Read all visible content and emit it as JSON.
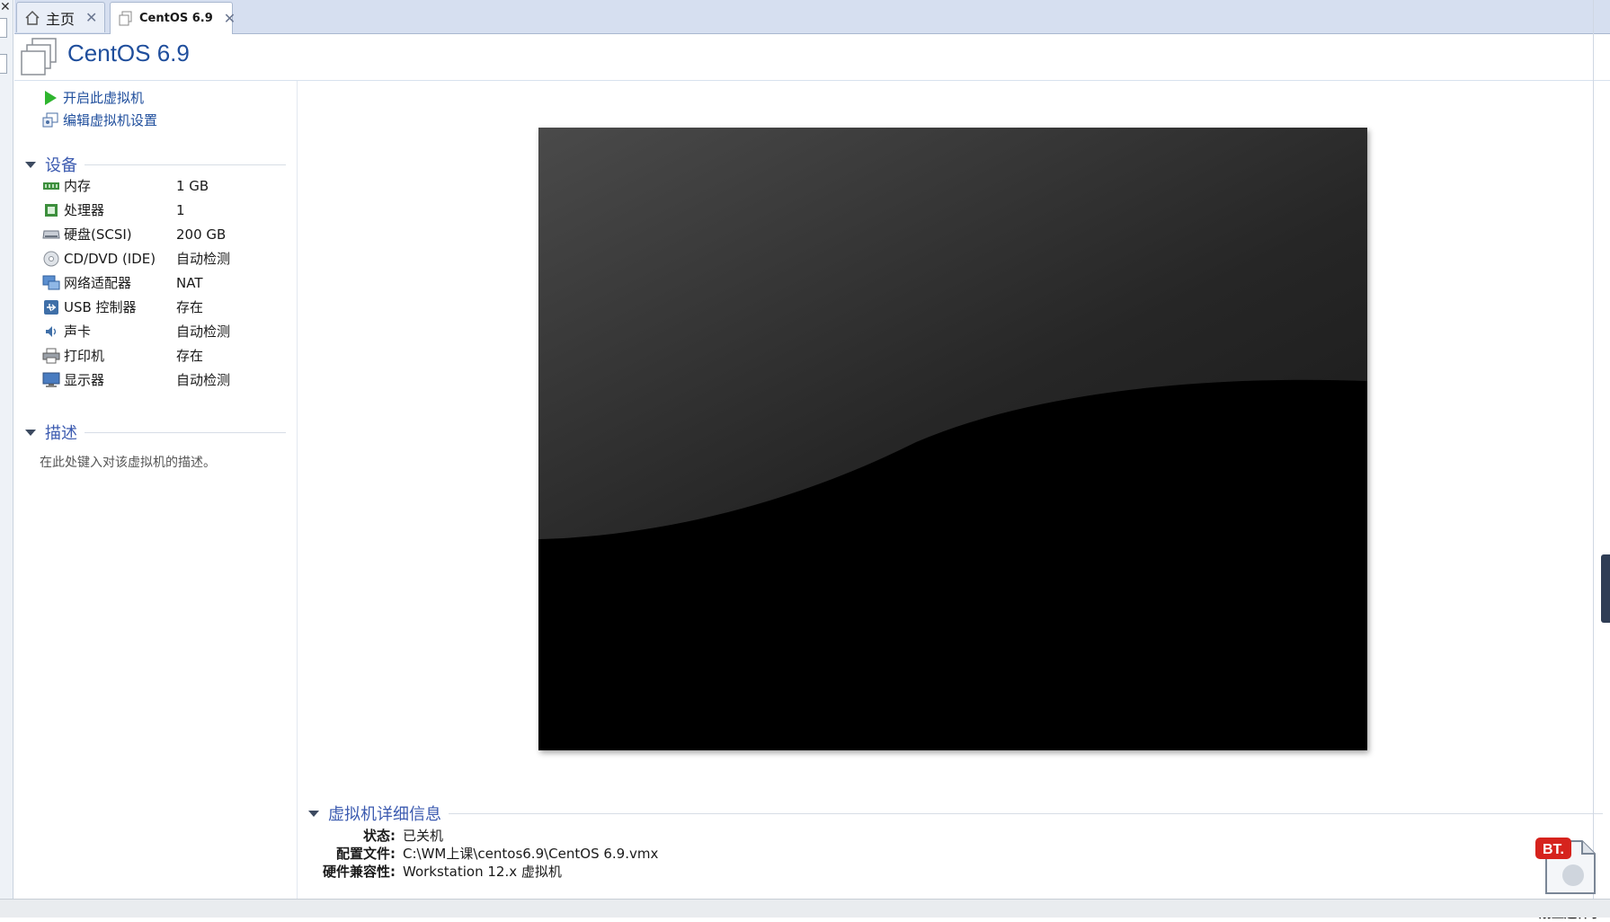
{
  "tabs": [
    {
      "label": "主页",
      "icon": "home-icon",
      "active": false
    },
    {
      "label": "CentOS 6.9",
      "icon": "vm-tab-icon",
      "active": true
    }
  ],
  "header": {
    "title": "CentOS 6.9"
  },
  "actions": [
    {
      "label": "开启此虚拟机",
      "icon": "power-on-icon"
    },
    {
      "label": "编辑虚拟机设置",
      "icon": "edit-settings-icon"
    }
  ],
  "devices_section": {
    "title": "设备"
  },
  "devices": [
    {
      "name": "内存",
      "value": "1 GB",
      "icon": "memory-icon"
    },
    {
      "name": "处理器",
      "value": "1",
      "icon": "processor-icon"
    },
    {
      "name": "硬盘(SCSI)",
      "value": "200 GB",
      "icon": "hard-disk-icon"
    },
    {
      "name": "CD/DVD (IDE)",
      "value": "自动检测",
      "icon": "cd-dvd-icon"
    },
    {
      "name": "网络适配器",
      "value": "NAT",
      "icon": "network-adapter-icon"
    },
    {
      "name": "USB 控制器",
      "value": "存在",
      "icon": "usb-icon"
    },
    {
      "name": "声卡",
      "value": "自动检测",
      "icon": "sound-card-icon"
    },
    {
      "name": "打印机",
      "value": "存在",
      "icon": "printer-icon"
    },
    {
      "name": "显示器",
      "value": "自动检测",
      "icon": "display-icon"
    }
  ],
  "description_section": {
    "title": "描述",
    "placeholder": "在此处键入对该虚拟机的描述。"
  },
  "details_section": {
    "title": "虚拟机详细信息",
    "rows": [
      {
        "label": "状态:",
        "value": "已关机"
      },
      {
        "label": "配置文件:",
        "value": "C:\\WM上课\\centos6.9\\CentOS 6.9.vmx"
      },
      {
        "label": "硬件兼容性:",
        "value": "Workstation 12.x 虚拟机"
      }
    ]
  },
  "bt_widget": {
    "badge": "BT.",
    "label": "扇丝送种子"
  },
  "colors": {
    "accent": "#1f4e9c",
    "section_title": "#3c5bb0",
    "tab_bar": "#d6dff0",
    "screen": "#000000"
  }
}
